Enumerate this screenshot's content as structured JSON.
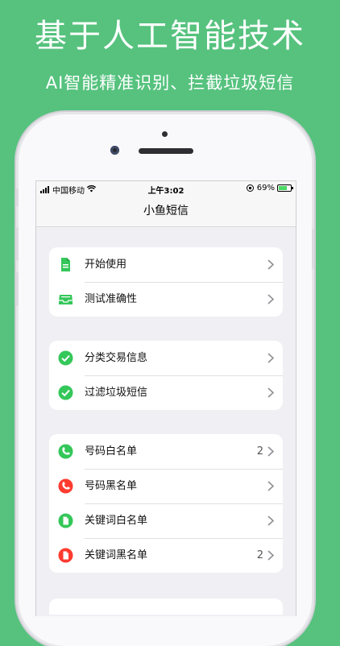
{
  "promo": {
    "headline": "基于人工智能技术",
    "subhead": "AI智能精准识别、拦截垃圾短信"
  },
  "status_bar": {
    "carrier": "中国移动",
    "time": "上午3:02",
    "battery": "69%"
  },
  "nav": {
    "title": "小鱼短信"
  },
  "groups": [
    {
      "items": [
        {
          "label": "开始使用",
          "icon": "document-icon"
        },
        {
          "label": "测试准确性",
          "icon": "inbox-tray-icon"
        }
      ]
    },
    {
      "items": [
        {
          "label": "分类交易信息",
          "icon": "check-circle-icon"
        },
        {
          "label": "过滤垃圾短信",
          "icon": "check-circle-icon"
        }
      ]
    },
    {
      "items": [
        {
          "label": "号码白名单",
          "icon": "phone-green-icon",
          "count": "2"
        },
        {
          "label": "号码黑名单",
          "icon": "phone-red-icon"
        },
        {
          "label": "关键词白名单",
          "icon": "doc-green-icon"
        },
        {
          "label": "关键词黑名单",
          "icon": "doc-red-icon",
          "count": "2"
        }
      ]
    }
  ],
  "colors": {
    "background": "#56c27e",
    "accent_green": "#34c759",
    "accent_red": "#ff3b30"
  }
}
